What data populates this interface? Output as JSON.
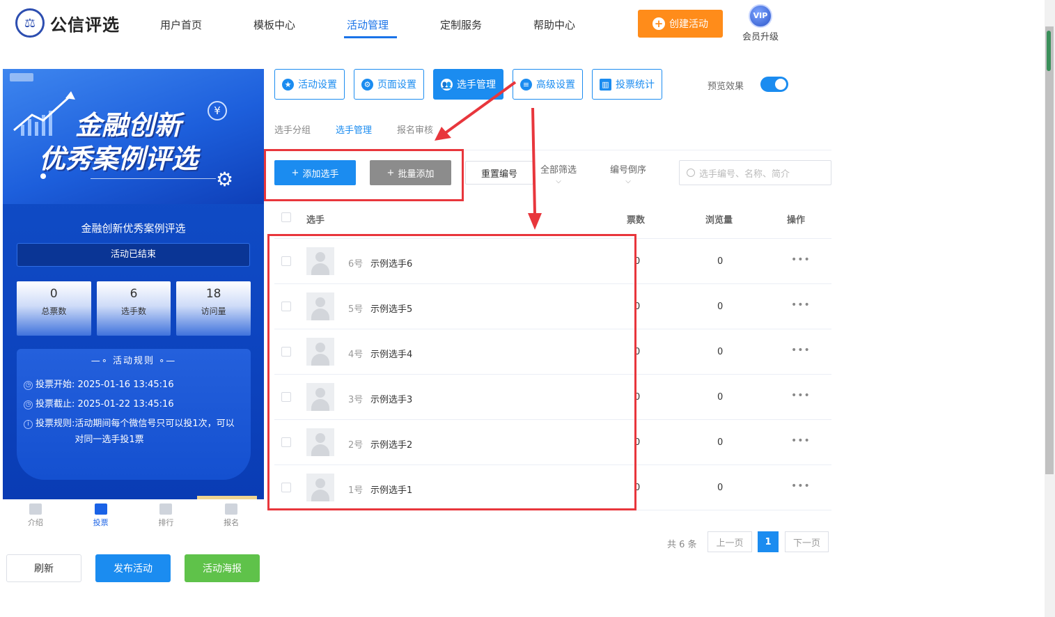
{
  "header": {
    "logo_text": "公信评选",
    "nav": [
      "用户首页",
      "模板中心",
      "活动管理",
      "定制服务",
      "帮助中心"
    ],
    "active_nav": "活动管理",
    "create_label": "创建活动",
    "vip_badge": "VIP",
    "vip_label": "会员升级"
  },
  "preview": {
    "banner_line1": "金融创新",
    "banner_line2": "优秀案例评选",
    "banner_currency": "¥",
    "title": "金融创新优秀案例评选",
    "status": "活动已结束",
    "stats": [
      {
        "value": "0",
        "label": "总票数"
      },
      {
        "value": "6",
        "label": "选手数"
      },
      {
        "value": "18",
        "label": "访问量"
      }
    ],
    "rules_title": "活动规则",
    "rules": [
      {
        "label": "投票开始:",
        "value": "2025-01-16 13:45:16"
      },
      {
        "label": "投票截止:",
        "value": "2025-01-22 13:45:16"
      },
      {
        "label": "投票规则:",
        "value": "活动期间每个微信号只可以投1次，可以对同一选手投1票"
      }
    ],
    "tabbar": [
      "介绍",
      "投票",
      "排行",
      "报名"
    ],
    "active_tab": "投票"
  },
  "actions": {
    "refresh": "刷新",
    "publish": "发布活动",
    "poster": "活动海报"
  },
  "settings_tabs": [
    "活动设置",
    "页面设置",
    "选手管理",
    "高级设置",
    "投票统计"
  ],
  "active_settings_tab": "选手管理",
  "preview_toggle": {
    "label": "预览效果",
    "on": true
  },
  "sub_tabs": [
    "选手分组",
    "选手管理",
    "报名审核"
  ],
  "active_sub_tab": "选手管理",
  "toolbar": {
    "add": "添加选手",
    "batch": "批量添加",
    "reset": "重置编号",
    "filter_all": "全部筛选",
    "sort": "编号倒序",
    "search_placeholder": "选手编号、名称、简介"
  },
  "table": {
    "headers": {
      "contestant": "选手",
      "votes": "票数",
      "views": "浏览量",
      "actions": "操作"
    },
    "rows": [
      {
        "no": "6号",
        "name": "示例选手6",
        "votes": "0",
        "views": "0"
      },
      {
        "no": "5号",
        "name": "示例选手5",
        "votes": "0",
        "views": "0"
      },
      {
        "no": "4号",
        "name": "示例选手4",
        "votes": "0",
        "views": "0"
      },
      {
        "no": "3号",
        "name": "示例选手3",
        "votes": "0",
        "views": "0"
      },
      {
        "no": "2号",
        "name": "示例选手2",
        "votes": "0",
        "views": "0"
      },
      {
        "no": "1号",
        "name": "示例选手1",
        "votes": "0",
        "views": "0"
      }
    ],
    "more": "•••"
  },
  "pagination": {
    "total": "共 6 条",
    "prev": "上一页",
    "current": "1",
    "next": "下一页"
  },
  "colors": {
    "primary": "#1b8cf0",
    "orange": "#ff8c1a",
    "green": "#5fc24a",
    "highlight": "#e8363c"
  }
}
